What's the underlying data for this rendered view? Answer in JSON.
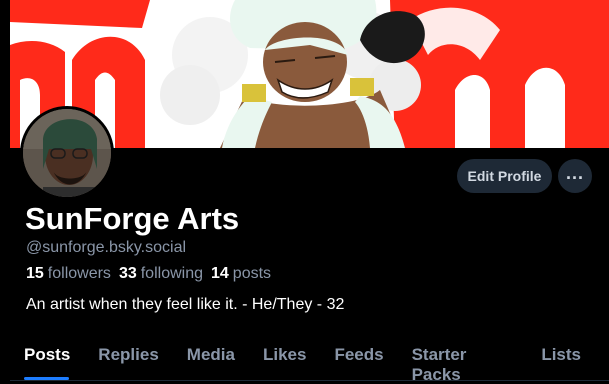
{
  "banner": {
    "colors": {
      "red": "#ff2a1a",
      "white": "#ffffff",
      "skin": "#8a5a3c"
    }
  },
  "profile": {
    "display_name": "SunForge Arts",
    "handle": "@sunforge.bsky.social",
    "stats": [
      {
        "value": "15",
        "label": "followers"
      },
      {
        "value": "33",
        "label": "following"
      },
      {
        "value": "14",
        "label": "posts"
      }
    ],
    "bio": "An artist when they feel like it. - He/They - 32"
  },
  "actions": {
    "edit_label": "Edit Profile",
    "more_label": "..."
  },
  "tabs": [
    {
      "label": "Posts",
      "active": true
    },
    {
      "label": "Replies"
    },
    {
      "label": "Media"
    },
    {
      "label": "Likes"
    },
    {
      "label": "Feeds"
    },
    {
      "label": "Starter Packs"
    },
    {
      "label": "Lists"
    }
  ],
  "theme": {
    "accent": "#1d7dff",
    "muted": "#8a96a8",
    "button_bg": "#1e2936"
  }
}
